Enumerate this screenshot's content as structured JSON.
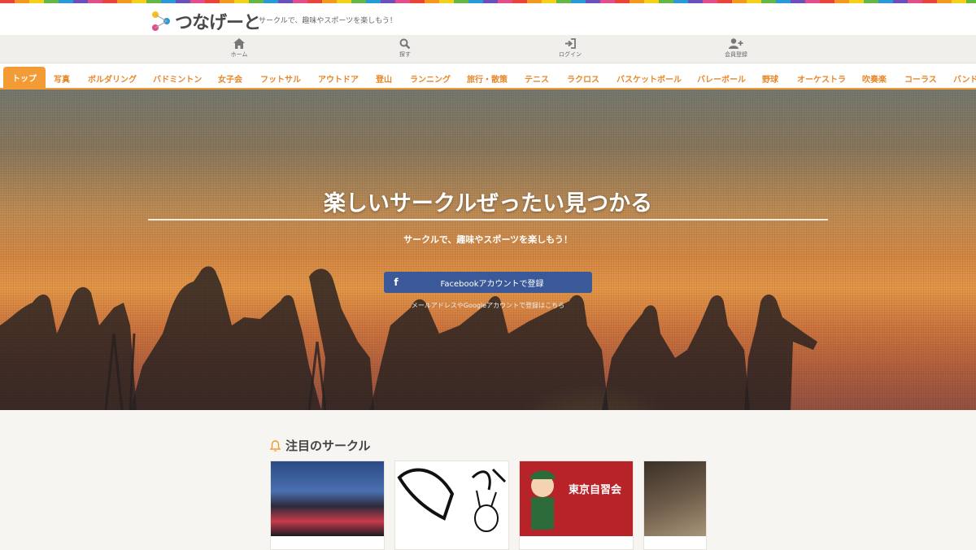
{
  "site": {
    "logo_text": "つなげーと",
    "tagline": "サークルで、趣味やスポーツを楽しもう！"
  },
  "iconbar": [
    {
      "label": "ホーム",
      "icon": "home-icon"
    },
    {
      "label": "探す",
      "icon": "search-icon"
    },
    {
      "label": "ログイン",
      "icon": "login-icon"
    },
    {
      "label": "会員登録",
      "icon": "user-plus-icon"
    }
  ],
  "nav": [
    {
      "label": "トップ",
      "active": true
    },
    {
      "label": "写真"
    },
    {
      "label": "ボルダリング"
    },
    {
      "label": "バドミントン"
    },
    {
      "label": "女子会"
    },
    {
      "label": "フットサル"
    },
    {
      "label": "アウトドア"
    },
    {
      "label": "登山"
    },
    {
      "label": "ランニング"
    },
    {
      "label": "旅行・散策"
    },
    {
      "label": "テニス"
    },
    {
      "label": "ラクロス"
    },
    {
      "label": "バスケットボール"
    },
    {
      "label": "バレーボール"
    },
    {
      "label": "野球"
    },
    {
      "label": "オーケストラ"
    },
    {
      "label": "吹奏楽"
    },
    {
      "label": "コーラス"
    },
    {
      "label": "バンド"
    }
  ],
  "hero": {
    "title": "楽しいサークルぜったい見つかる",
    "subtitle": "サークルで、趣味やスポーツを楽しもう！",
    "facebook_button": "Facebookアカウントで登録",
    "facebook_icon": "f",
    "email_link": "メールアドレスやGoogleアカウントで登録はこちら"
  },
  "featured": {
    "heading": "注目のサークル",
    "cards": [
      {
        "image": "city-night-photo"
      },
      {
        "image": "hand-drawn-rabbit-logo"
      },
      {
        "image": "tokyo-study-group-banner",
        "caption": "東京自習会"
      },
      {
        "image": "interior-photo"
      }
    ]
  },
  "colors": {
    "accent": "#f39c36",
    "facebook": "#3b5998"
  }
}
